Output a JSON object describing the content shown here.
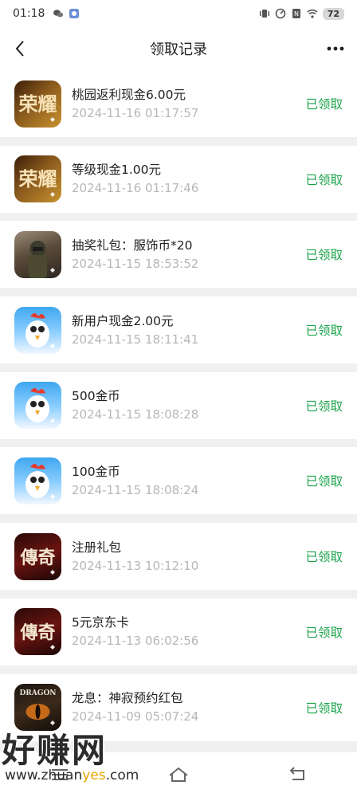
{
  "status_bar": {
    "time": "01:18",
    "battery": "72"
  },
  "header": {
    "title": "领取记录"
  },
  "items": [
    {
      "title": "桃园返利现金6.00元",
      "time": "2024-11-16 01:17:57",
      "status": "已领取",
      "icon": "game-glory"
    },
    {
      "title": "等级现金1.00元",
      "time": "2024-11-16 01:17:46",
      "status": "已领取",
      "icon": "game-glory"
    },
    {
      "title": "抽奖礼包：服饰币*20",
      "time": "2024-11-15 18:53:52",
      "status": "已领取",
      "icon": "game-pubg"
    },
    {
      "title": "新用户现金2.00元",
      "time": "2024-11-15 18:11:41",
      "status": "已领取",
      "icon": "game-chicken"
    },
    {
      "title": "500金币",
      "time": "2024-11-15 18:08:28",
      "status": "已领取",
      "icon": "game-chicken"
    },
    {
      "title": "100金币",
      "time": "2024-11-15 18:08:24",
      "status": "已领取",
      "icon": "game-chicken"
    },
    {
      "title": "注册礼包",
      "time": "2024-11-13 10:12:10",
      "status": "已领取",
      "icon": "game-legend"
    },
    {
      "title": "5元京东卡",
      "time": "2024-11-13 06:02:56",
      "status": "已领取",
      "icon": "game-legend"
    },
    {
      "title": "龙息：神寂预约红包",
      "time": "2024-11-09 05:07:24",
      "status": "已领取",
      "icon": "game-dragon"
    }
  ],
  "icon_text": {
    "glory": "荣耀",
    "legend": "傳奇",
    "dragon": "DRAGON"
  },
  "watermark": {
    "main": "好赚网",
    "url_pre": "www.zhuan",
    "url_hl": "yes",
    "url_post": ".com"
  },
  "colors": {
    "status_green": "#1aa34a",
    "time_gray": "#b7b7b7"
  }
}
